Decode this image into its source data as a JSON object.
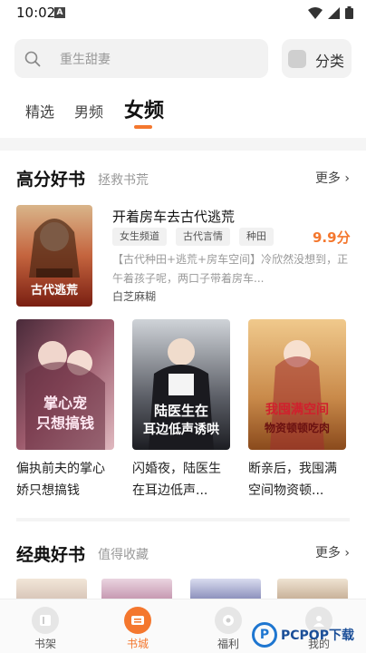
{
  "status_bar": {
    "time": "10:02",
    "notif_letter": "A"
  },
  "search": {
    "placeholder": "重生甜妻"
  },
  "category_button": {
    "label": "分类"
  },
  "tabs": [
    {
      "label": "精选"
    },
    {
      "label": "男频"
    },
    {
      "label": "女频",
      "active": true
    }
  ],
  "section_high": {
    "title": "高分好书",
    "subtitle": "拯救书荒",
    "more": "更多 ›"
  },
  "featured": {
    "title": "开着房车去古代逃荒",
    "tags": [
      "女生频道",
      "古代言情",
      "种田"
    ],
    "score": "9.9分",
    "description": "【古代种田+逃荒+房车空间】冷欣然没想到，正午着孩子呢，两口子带着房车...",
    "author": "白芝麻糊",
    "cover_text": "古代逃荒"
  },
  "grid_books": [
    {
      "title": "偏执前夫的掌心娇只想搞钱",
      "cover_text": "掌心宠只想搞钱"
    },
    {
      "title": "闪婚夜，陆医生在耳边低声...",
      "cover_text": "陆医生在耳边低声诱哄"
    },
    {
      "title": "断亲后，我囤满空间物资顿...",
      "cover_text": "我囤满空间物资顿顿吃肉"
    }
  ],
  "section_classic": {
    "title": "经典好书",
    "subtitle": "值得收藏",
    "more": "更多 ›"
  },
  "nav": [
    {
      "label": "书架"
    },
    {
      "label": "书城",
      "active": true
    },
    {
      "label": "福利"
    },
    {
      "label": "我的"
    }
  ],
  "watermark": {
    "circle": "P",
    "text": "PCPOP下载"
  },
  "colors": {
    "accent": "#f4772e"
  }
}
